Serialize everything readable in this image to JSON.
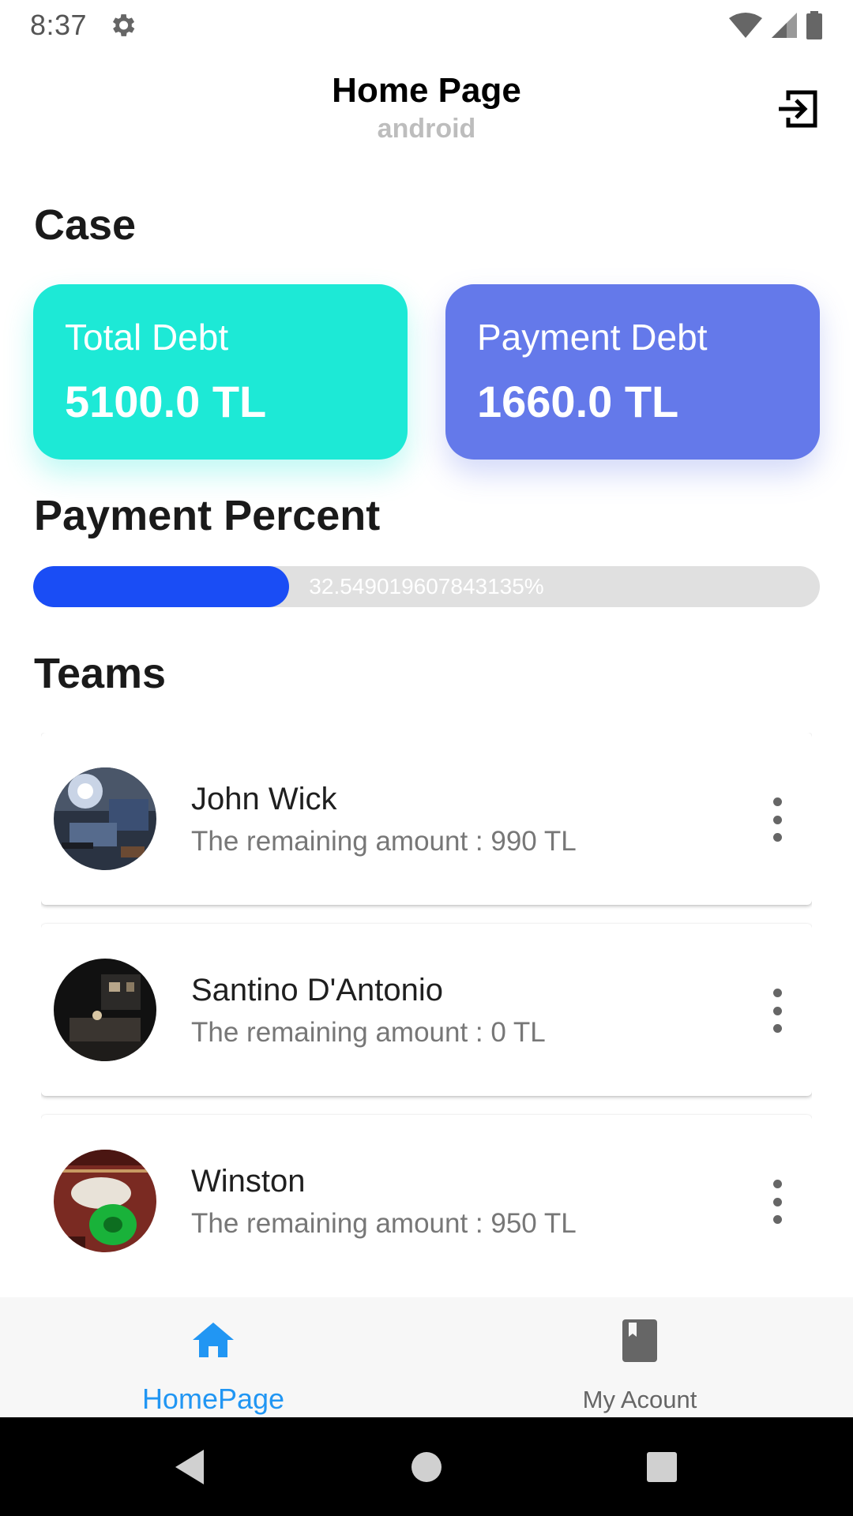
{
  "status_bar": {
    "time": "8:37"
  },
  "app_bar": {
    "title": "Home Page",
    "subtitle": "android"
  },
  "case": {
    "heading": "Case",
    "total_debt": {
      "label": "Total Debt",
      "value": "5100.0 TL",
      "color": "#1de9d6"
    },
    "payment_debt": {
      "label": "Payment Debt",
      "value": "1660.0 TL",
      "color": "#6479ea"
    }
  },
  "payment_percent": {
    "heading": "Payment Percent",
    "text": "32.549019607843135%",
    "fraction": 0.3255
  },
  "teams": {
    "heading": "Teams",
    "items": [
      {
        "name": "John Wick",
        "remaining": "The remaining amount : 990 TL"
      },
      {
        "name": "Santino D'Antonio",
        "remaining": "The remaining amount : 0 TL"
      },
      {
        "name": "Winston",
        "remaining": "The remaining amount : 950 TL"
      }
    ]
  },
  "bottom_nav": {
    "home": {
      "label": "HomePage",
      "icon": "home-icon",
      "active": true
    },
    "account": {
      "label": "My Acount",
      "icon": "book-icon",
      "active": false
    }
  },
  "colors": {
    "accent": "#2196f3",
    "progress_fill": "#1a4df5",
    "progress_track": "#e0e0e0"
  }
}
